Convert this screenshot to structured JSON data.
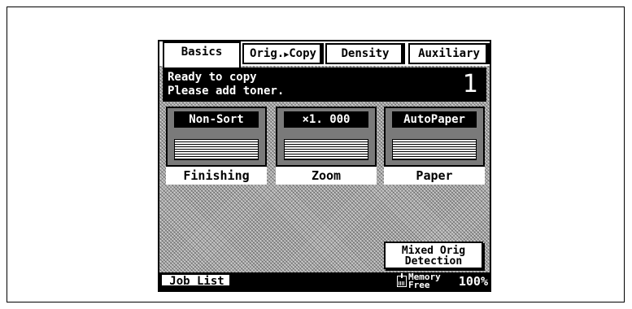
{
  "tabs": [
    {
      "label": "Basics",
      "active": true
    },
    {
      "label": "Orig.",
      "arrow": "▶",
      "label2": "Copy",
      "active": false
    },
    {
      "label": "Density",
      "active": false
    },
    {
      "label": "Auxiliary",
      "active": false
    }
  ],
  "status": {
    "line1": "Ready to copy",
    "line2": "Please add toner.",
    "copies": "1"
  },
  "functions": [
    {
      "value": "Non-Sort",
      "label": "Finishing"
    },
    {
      "value": "×1. 000",
      "label": "Zoom"
    },
    {
      "value": "AutoPaper",
      "label": "Paper"
    }
  ],
  "mixed_button": {
    "line1": "Mixed Orig",
    "line2": "Detection"
  },
  "bottom_bar": {
    "job_list": "Job List",
    "memory_line1": "Memory",
    "memory_line2": "Free",
    "memory_value": "100%"
  },
  "icons": {
    "memory": "memory-icon",
    "tab_arrow": "right-arrow-icon"
  }
}
